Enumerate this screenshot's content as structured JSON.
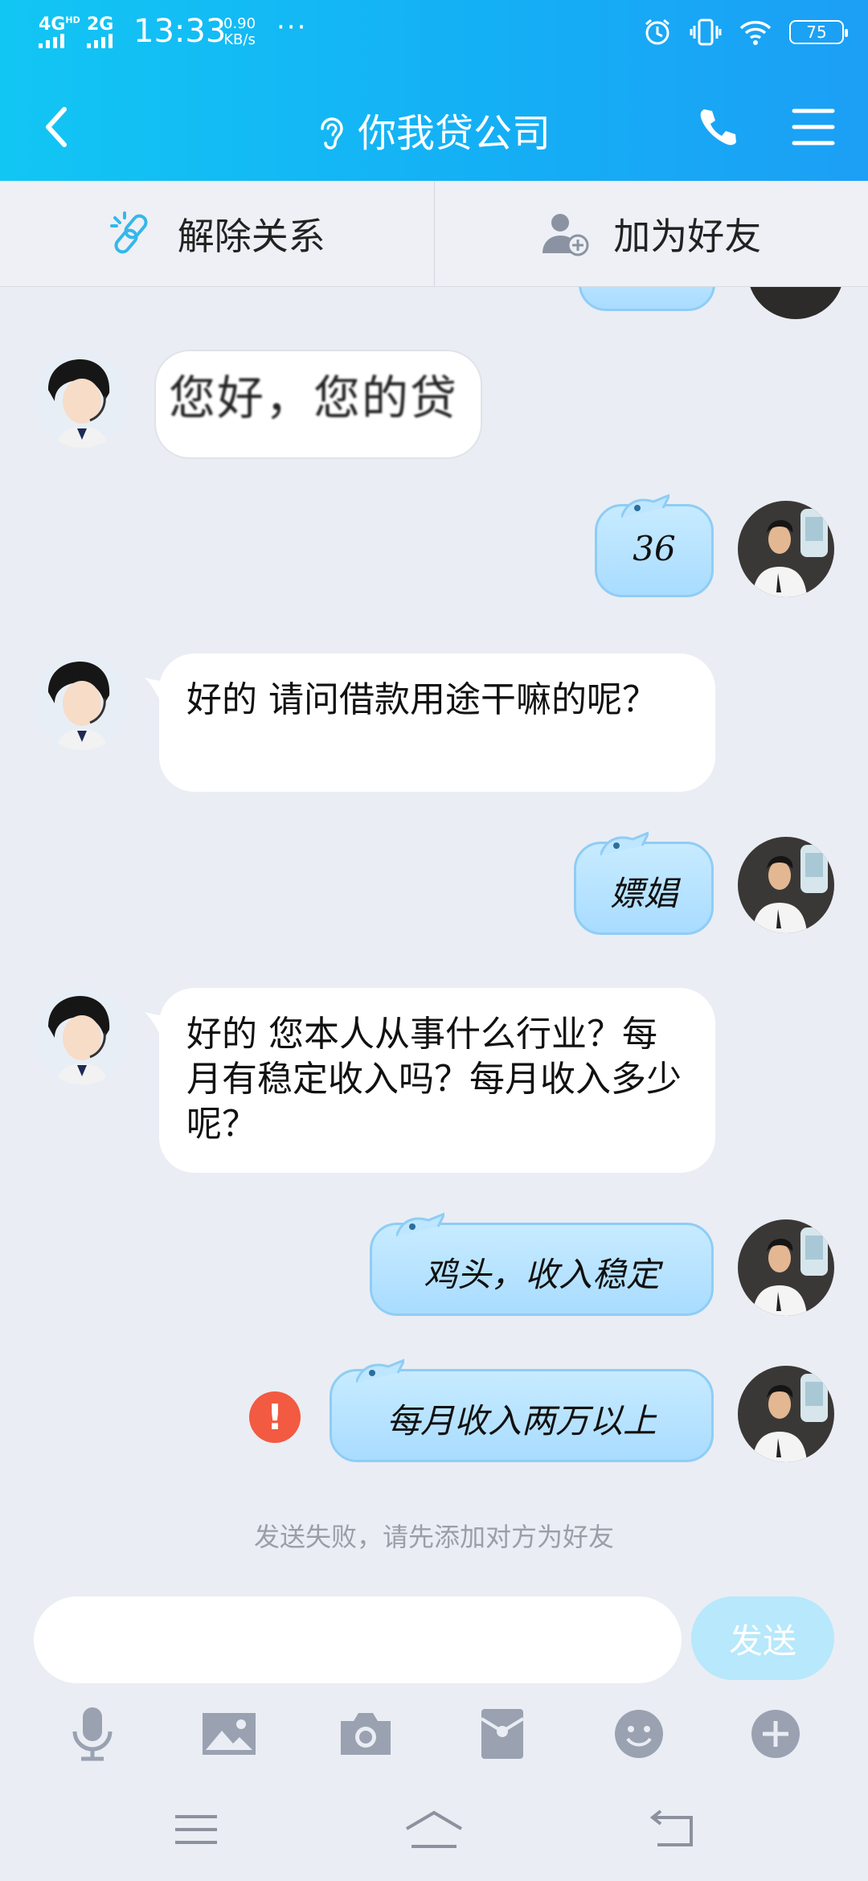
{
  "status_bar": {
    "network1": "4G",
    "network1_sup": "HD",
    "network2": "2G",
    "time": "13:33",
    "speed_value": "0.90",
    "speed_unit": "KB/s",
    "more": "···",
    "battery": "75"
  },
  "header": {
    "title": "你我贷公司",
    "icons": [
      "back-icon",
      "ear-icon",
      "phone-icon",
      "menu-icon"
    ]
  },
  "actions": [
    {
      "label": "解除关系",
      "icon": "unlink-icon"
    },
    {
      "label": "加为好友",
      "icon": "add-friend-icon"
    }
  ],
  "messages": [
    {
      "side": "in",
      "text": "您好，您的贷",
      "pixelated": true
    },
    {
      "side": "out",
      "text": "36"
    },
    {
      "side": "in",
      "text": "好的 请问借款用途干嘛的呢？"
    },
    {
      "side": "out",
      "text": "嫖娼"
    },
    {
      "side": "in",
      "text": "好的 您本人从事什么行业？每月有稳定收入吗？每月收入多少呢？"
    },
    {
      "side": "out",
      "text": "鸡头，收入稳定"
    },
    {
      "side": "out",
      "text": "每月收入两万以上",
      "failed": true
    }
  ],
  "failed_icon": "!",
  "notice": "发送失败，请先添加对方为好友",
  "composer": {
    "placeholder": "",
    "send_label": "发送"
  },
  "toolbar": [
    "mic-icon",
    "image-icon",
    "camera-icon",
    "red-packet-icon",
    "emoji-icon",
    "plus-icon"
  ],
  "navigation": [
    "menu-nav-icon",
    "home-nav-icon",
    "back-nav-icon"
  ],
  "colors": {
    "header_start": "#12c6f4",
    "header_end": "#1c9ff5",
    "background": "#eaedf4",
    "out_bubble": "#b0dfff",
    "send_button": "#b7e8fb",
    "error": "#f25a41"
  }
}
